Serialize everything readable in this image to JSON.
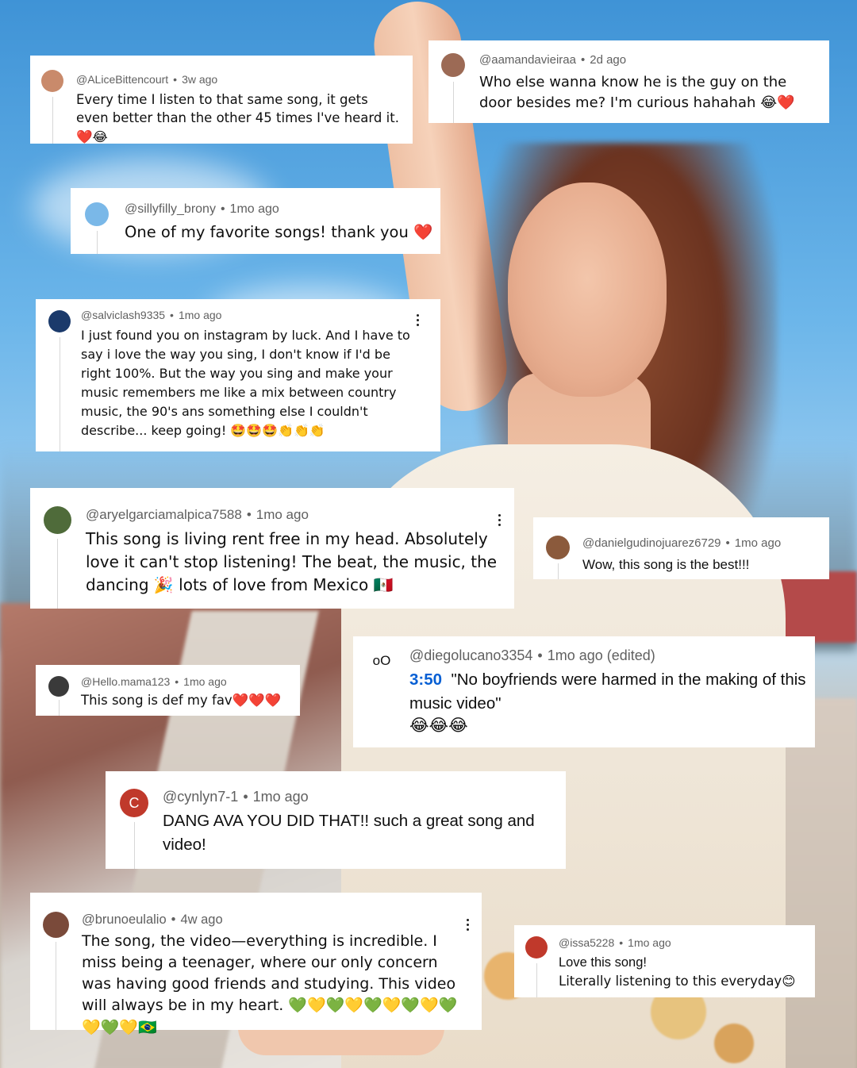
{
  "comments": [
    {
      "user": "@ALiceBittencourt",
      "time": "3w ago",
      "text": "Every time I listen to that same song, it gets even better than the other 45 times I've heard it. ❤️😂",
      "avatar_color": "#c98a6b"
    },
    {
      "user": "@aamandavieiraa",
      "time": "2d ago",
      "text": "Who else wanna know he is the guy on the door besides me? I'm curious hahahah 😂❤️",
      "avatar_color": "#9c6a55"
    },
    {
      "user": "@sillyfilly_brony",
      "time": "1mo ago",
      "text": "One of my favorite songs! thank you ❤️",
      "avatar_color": "#7ab8e8"
    },
    {
      "user": "@salviclash9335",
      "time": "1mo ago",
      "text": "I just found you on instagram by luck. And I have to say i love the way you sing, I don't know if I'd be right 100%. But the way you sing and make your music remembers me like a mix between country music, the 90's ans something else I couldn't describe... keep going! 🤩🤩🤩👏👏👏",
      "avatar_color": "#1b3a6b"
    },
    {
      "user": "@aryelgarciamalpica7588",
      "time": "1mo ago",
      "text": "This song is living rent free in my head. Absolutely love it can't stop listening! The beat, the music, the dancing 🎉 lots of love from Mexico 🇲🇽",
      "avatar_color": "#4f6b3a"
    },
    {
      "user": "@danielgudinojuarez6729",
      "time": "1mo ago",
      "text": "Wow, this song is the best!!!",
      "avatar_color": "#8b5a3c"
    },
    {
      "user": "@Hello.mama123",
      "time": "1mo ago",
      "text": "This song is def my fav❤️❤️❤️",
      "avatar_color": "#3a3a3a"
    },
    {
      "user": "@diegolucano3354",
      "time": "1mo ago (edited)",
      "timestamp": "3:50",
      "text": "\"No boyfriends were harmed in the making of this music video\"",
      "emojis": "😂😂😂",
      "avatar_symbol": "oO"
    },
    {
      "user": "@cynlyn7-1",
      "time": "1mo ago",
      "text": "DANG AVA YOU DID THAT!! such a great song and video!",
      "avatar_letter": "C",
      "avatar_color": "#c0392b"
    },
    {
      "user": "@brunoeulalio",
      "time": "4w ago",
      "text": "The song, the video—everything is incredible. I miss being a teenager, where our only concern was having good friends and studying. This video will always be in my heart. 💚💛💚💛💚💛💚💛💚💛💚💛🇧🇷",
      "avatar_color": "#7a4a3a"
    },
    {
      "user": "@issa5228",
      "time": "1mo ago",
      "text_line1": "Love this song!",
      "text_line2": "Literally listening to this everyday😊",
      "avatar_color": "#c0392b"
    }
  ],
  "colors": {
    "timestamp_link": "#065fd4",
    "meta": "#606060",
    "text": "#0f0f0f"
  },
  "icons": {
    "more": "kebab-more-icon"
  }
}
